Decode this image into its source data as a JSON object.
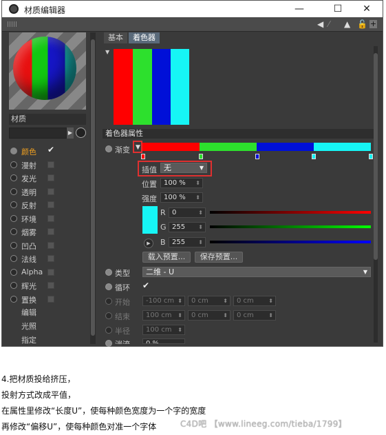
{
  "window": {
    "title": "材质编辑器",
    "buttons": {
      "minimize": "—",
      "maximize": "☐",
      "close": "✕"
    }
  },
  "left_panel": {
    "material_label": "材质",
    "channels": [
      {
        "label": "颜色",
        "checked": true,
        "active": true
      },
      {
        "label": "漫射",
        "checked": false
      },
      {
        "label": "发光",
        "checked": false
      },
      {
        "label": "透明",
        "checked": false
      },
      {
        "label": "反射",
        "checked": false
      },
      {
        "label": "环境",
        "checked": false
      },
      {
        "label": "烟雾",
        "checked": false
      },
      {
        "label": "凹凸",
        "checked": false
      },
      {
        "label": "法线",
        "checked": false
      },
      {
        "label": "Alpha",
        "checked": false
      },
      {
        "label": "辉光",
        "checked": false
      },
      {
        "label": "置换",
        "checked": false
      }
    ],
    "sub_items": [
      "编辑",
      "光照",
      "指定"
    ]
  },
  "right_panel": {
    "tabs": [
      "基本",
      "着色器"
    ],
    "section_title": "着色器属性",
    "gradient_label": "渐变",
    "interp_label": "插值",
    "interp_value": "无",
    "position_label": "位置",
    "position_value": "100 %",
    "intensity_label": "强度",
    "intensity_value": "100 %",
    "r_label": "R",
    "r_value": "0",
    "g_label": "G",
    "g_value": "255",
    "b_label": "B",
    "b_value": "255",
    "load_preset": "载入预置...",
    "save_preset": "保存预置...",
    "type_label": "类型",
    "type_value": "二维 - U",
    "cycle_label": "循环",
    "start_label": "开始",
    "start_values": [
      "-100 cm",
      "0 cm",
      "0 cm"
    ],
    "end_label": "结束",
    "end_values": [
      "100 cm",
      "0 cm",
      "0 cm"
    ],
    "radius_label": "半径",
    "radius_value": "100 cm",
    "turb_label": "湍流",
    "turb_value": "0 %",
    "gradient_colors": [
      "#ff0000",
      "#2de02d",
      "#0010d8",
      "#16f5f5"
    ],
    "current_color": "#16f5f5"
  },
  "captions": [
    "4.把材质投给挤压，",
    "投射方式改成平值，",
    "在属性里修改“长度U”，使每种颜色宽度为一个字的宽度",
    "再修改“偏移U”，使每种颜色对准一个字体"
  ],
  "watermark": "C4D吧 【www.lineeg.com/tieba/1799】"
}
